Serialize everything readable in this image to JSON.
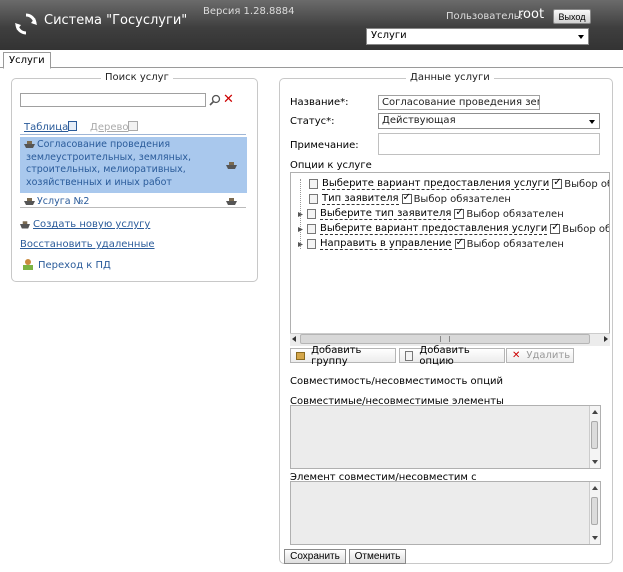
{
  "header": {
    "title": "Система \"Госуслуги\"",
    "version": "Версия 1.28.8884",
    "user_label": "Пользователь:",
    "user_name": "root",
    "logout_label": "Выход",
    "service_select_value": "Услуги"
  },
  "tabs": {
    "services": "Услуги"
  },
  "search": {
    "legend": "Поиск услуг",
    "tab_table": "Таблица",
    "tab_tree": "Дерево",
    "items": [
      {
        "label": "Согласование проведения землеустроительных, земляных, строительных, мелиоративных, хозяйственных и иных работ",
        "selected": true
      },
      {
        "label": "Услуга №2",
        "selected": false
      }
    ],
    "create_link": "Создать новую услугу",
    "restore_link": "Восстановить удаленные",
    "pd_link": "Переход к ПД"
  },
  "service_data": {
    "legend": "Данные услуги",
    "name_label": "Название*:",
    "name_value": "Согласование проведения землеу",
    "status_label": "Статус*:",
    "status_value": "Действующая",
    "note_label": "Примечание:",
    "options_label": "Опции к услуге",
    "required_label": "Выбор обязателен",
    "tree": [
      {
        "title": "Выберите вариант предоставления услуги",
        "expandable": false
      },
      {
        "title": "Тип заявителя",
        "expandable": false
      },
      {
        "title": "Выберите тип заявителя",
        "expandable": true
      },
      {
        "title": "Выберите вариант предоставления услуги",
        "expandable": true
      },
      {
        "title": "Направить в управление",
        "expandable": true
      }
    ],
    "toolbar": {
      "add_group": "Добавить группу",
      "add_option": "Добавить опцию",
      "delete": "Удалить"
    },
    "compat_label": "Совместимость/несовместимость опций",
    "compat_elements_label": "Совместимые/несовместимые элементы",
    "compat_with_label": "Элемент совместим/несовместим с",
    "save": "Сохранить",
    "cancel": "Отменить"
  }
}
